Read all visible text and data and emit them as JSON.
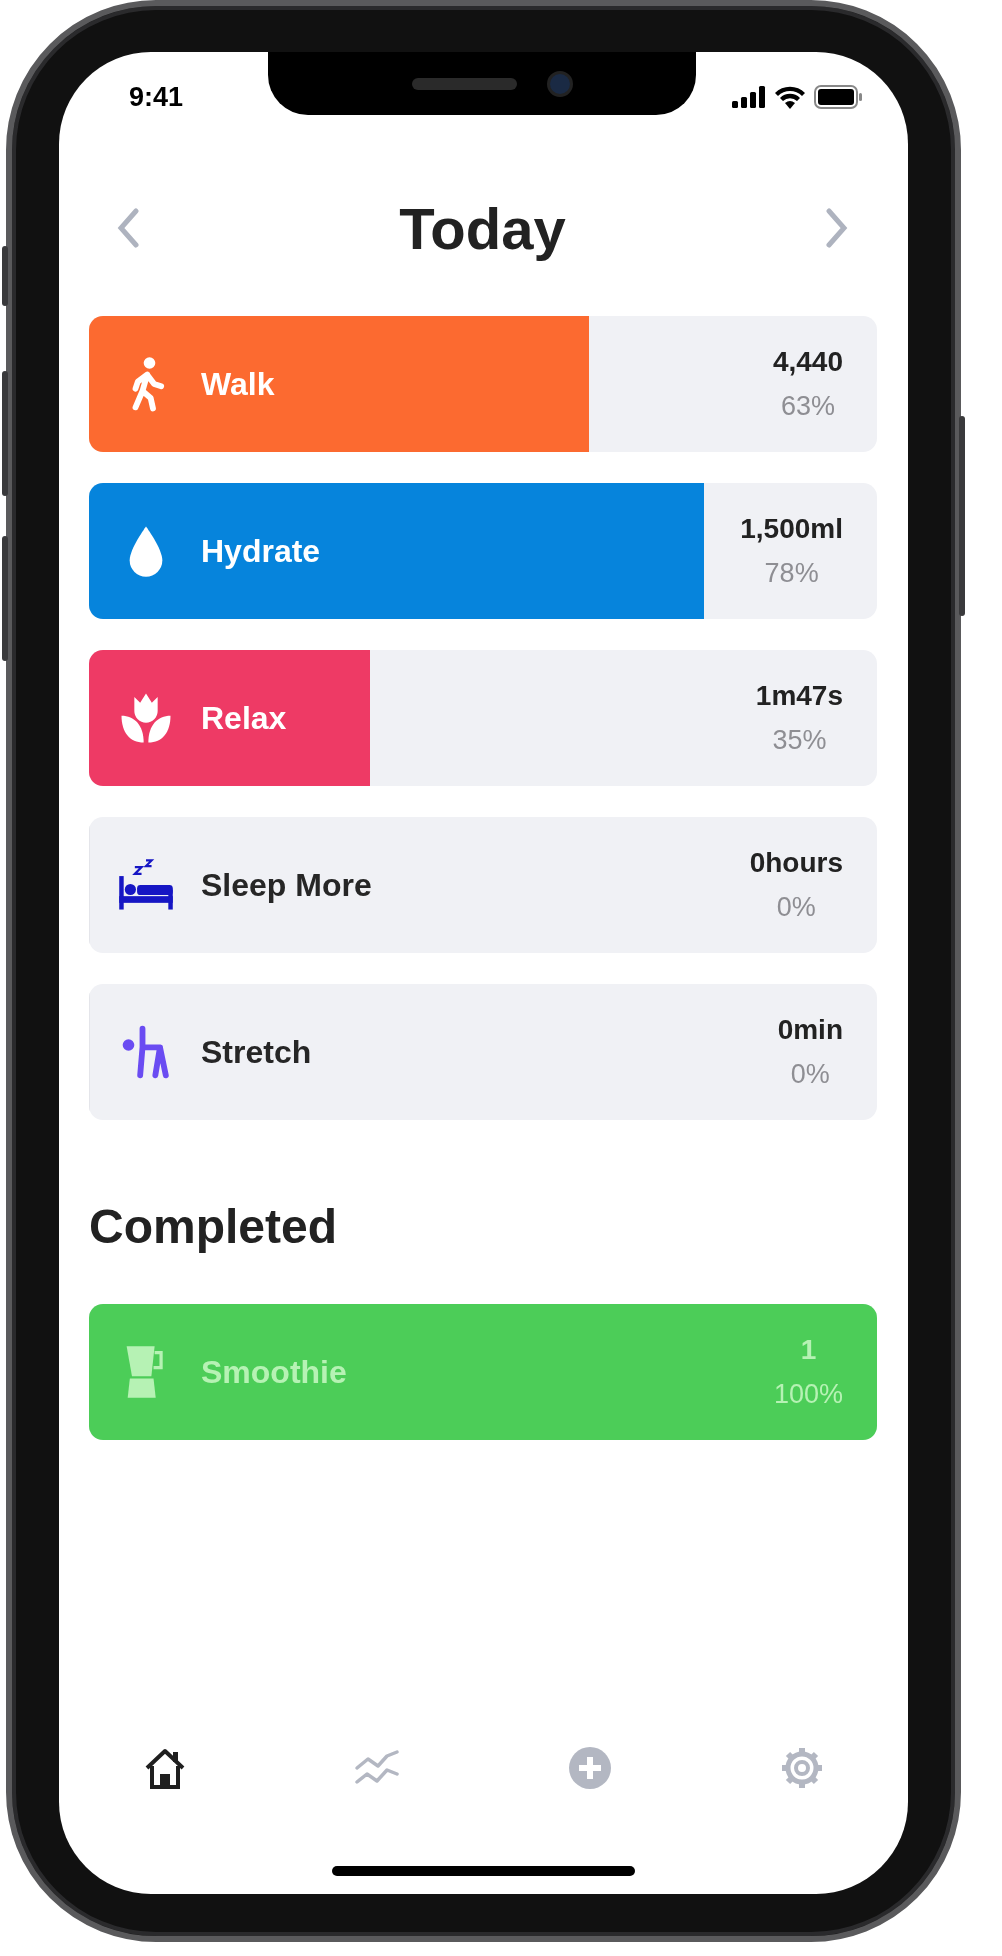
{
  "status_bar": {
    "time": "9:41"
  },
  "header": {
    "title": "Today"
  },
  "goals": [
    {
      "kind": "walk",
      "label": "Walk",
      "value": "4,440",
      "percent": "63%",
      "level": 0.634,
      "color": "#fc6a30"
    },
    {
      "kind": "drop",
      "label": "Hydrate",
      "value": "1,500ml",
      "percent": "78%",
      "level": 0.78,
      "color": "#0684dc"
    },
    {
      "kind": "lotus",
      "label": "Relax",
      "value": "1m47s",
      "percent": "35%",
      "level": 0.356,
      "color": "#ee3a65"
    },
    {
      "kind": "bed",
      "label": "Sleep More",
      "value": "0hours",
      "percent": "0%",
      "level": 0,
      "color": "#1616c4"
    },
    {
      "kind": "stretch",
      "label": "Stretch",
      "value": "0min",
      "percent": "0%",
      "level": 0,
      "color": "#6a4cf2"
    }
  ],
  "completed": {
    "title": "Completed",
    "goals": [
      {
        "kind": "blender",
        "label": "Smoothie",
        "value": "1",
        "percent": "100%",
        "level": 1,
        "color": "#4ccd58"
      }
    ]
  },
  "tab_bar": [
    {
      "kind": "home",
      "selected": true
    },
    {
      "kind": "trends",
      "selected": false
    },
    {
      "kind": "add",
      "selected": false
    },
    {
      "kind": "settings",
      "selected": false
    }
  ]
}
